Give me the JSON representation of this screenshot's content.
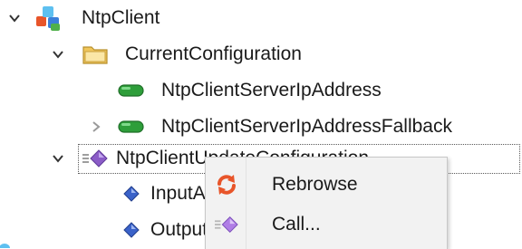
{
  "tree": {
    "root": {
      "label": "NtpClient",
      "icon": "cube-cluster-icon",
      "expanded": true
    },
    "folder": {
      "label": "CurrentConfiguration",
      "icon": "folder-icon",
      "expanded": true
    },
    "var1": {
      "label": "NtpClientServerIpAddress",
      "icon": "variable-icon"
    },
    "var2": {
      "label": "NtpClientServerIpAddressFallback",
      "icon": "variable-icon",
      "expanded": false
    },
    "method": {
      "label": "NtpClientUpdateConfiguration",
      "icon": "method-icon",
      "expanded": true
    },
    "arg1": {
      "label": "InputArguments",
      "icon": "property-icon"
    },
    "arg2": {
      "label": "OutputArguments",
      "icon": "property-icon"
    }
  },
  "context_menu": {
    "items": [
      {
        "label": "Rebrowse",
        "icon": "refresh-icon"
      },
      {
        "label": "Call...",
        "icon": "method-call-icon"
      }
    ]
  },
  "colors": {
    "variable_green": "#2e9e3a",
    "folder_yellow": "#f0c65a",
    "method_purple": "#8b5cc7",
    "property_blue": "#3a62c9",
    "refresh_orange": "#e8552a"
  }
}
